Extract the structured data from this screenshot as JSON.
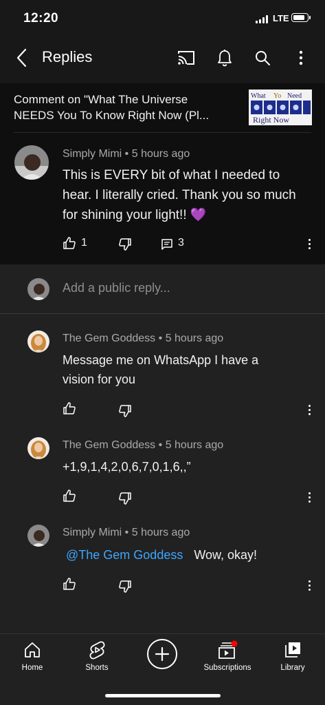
{
  "status_bar": {
    "time": "12:20",
    "network": "LTE",
    "battery_level": 0.8
  },
  "app_bar": {
    "title": "Replies",
    "icons": [
      "back-arrow-icon",
      "cast-icon",
      "bell-icon",
      "search-icon",
      "more-vertical-icon"
    ]
  },
  "context": {
    "line1": "Comment on \"What The Universe",
    "line2": "NEEDS You To Know Right Now (Pl...",
    "thumbnail": {
      "line1_a": "What",
      "line1_b": "Yo",
      "line1_c": "Need",
      "line2": "Right Now"
    }
  },
  "parent_comment": {
    "author": "Simply Mimi",
    "time": "5 hours ago",
    "lines": [
      "This is EVERY bit of what I needed to",
      "hear. I literally cried. Thank you so much",
      "for shining your light!! 💜"
    ],
    "likes": "1",
    "replies": "3"
  },
  "reply_box": {
    "placeholder": "Add a public reply..."
  },
  "replies": [
    {
      "author": "The Gem Goddess",
      "time": "5 hours ago",
      "lines": [
        "Message me on WhatsApp I have a",
        "vision for you"
      ]
    },
    {
      "author": "The Gem Goddess",
      "time": "5 hours ago",
      "lines": [
        "+1,9,1,4,2,0,6,7,0,1,6,,”"
      ]
    },
    {
      "author": "Simply Mimi",
      "time": "5 hours ago",
      "mention": "@The Gem Goddess",
      "text": "Wow, okay!"
    }
  ],
  "separator": "•",
  "bottom_nav": [
    {
      "label": "Home",
      "icon": "home-icon"
    },
    {
      "label": "Shorts",
      "icon": "shorts-icon"
    },
    {
      "label": "",
      "icon": "create-icon"
    },
    {
      "label": "Subscriptions",
      "icon": "subscriptions-icon"
    },
    {
      "label": "Library",
      "icon": "library-icon"
    }
  ],
  "colors": {
    "background": "#181818",
    "panel": "#212121",
    "highlight": "#0f0f0f",
    "mention": "#3ea6ff",
    "notification": "#ff0000"
  }
}
